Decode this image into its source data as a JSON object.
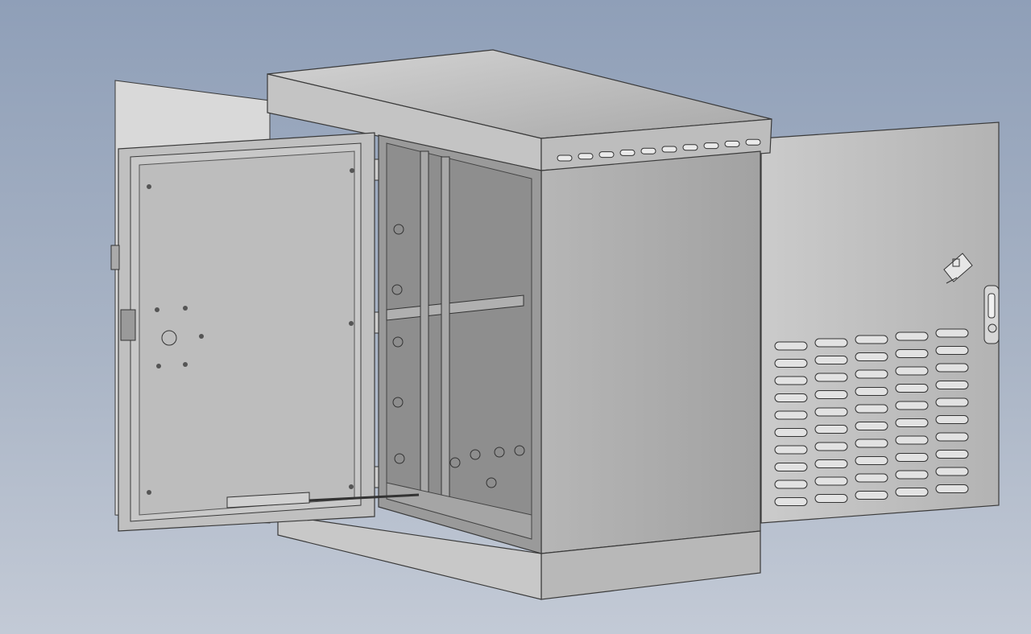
{
  "viewport": {
    "background_top": "#8f9fb8",
    "background_bottom": "#c3cad6"
  },
  "model": {
    "object": "cabinet-enclosure",
    "colors": {
      "face_light": "#c9c9c9",
      "face_mid": "#b3b3b3",
      "face_dark": "#9e9e9e",
      "edge": "#3a3a3a",
      "interior": "#8c8c8c"
    },
    "front_door": {
      "state": "open"
    },
    "side_door": {
      "state": "open"
    },
    "vent_rows": 10,
    "vent_columns": 5,
    "top_vent_count": 10
  }
}
